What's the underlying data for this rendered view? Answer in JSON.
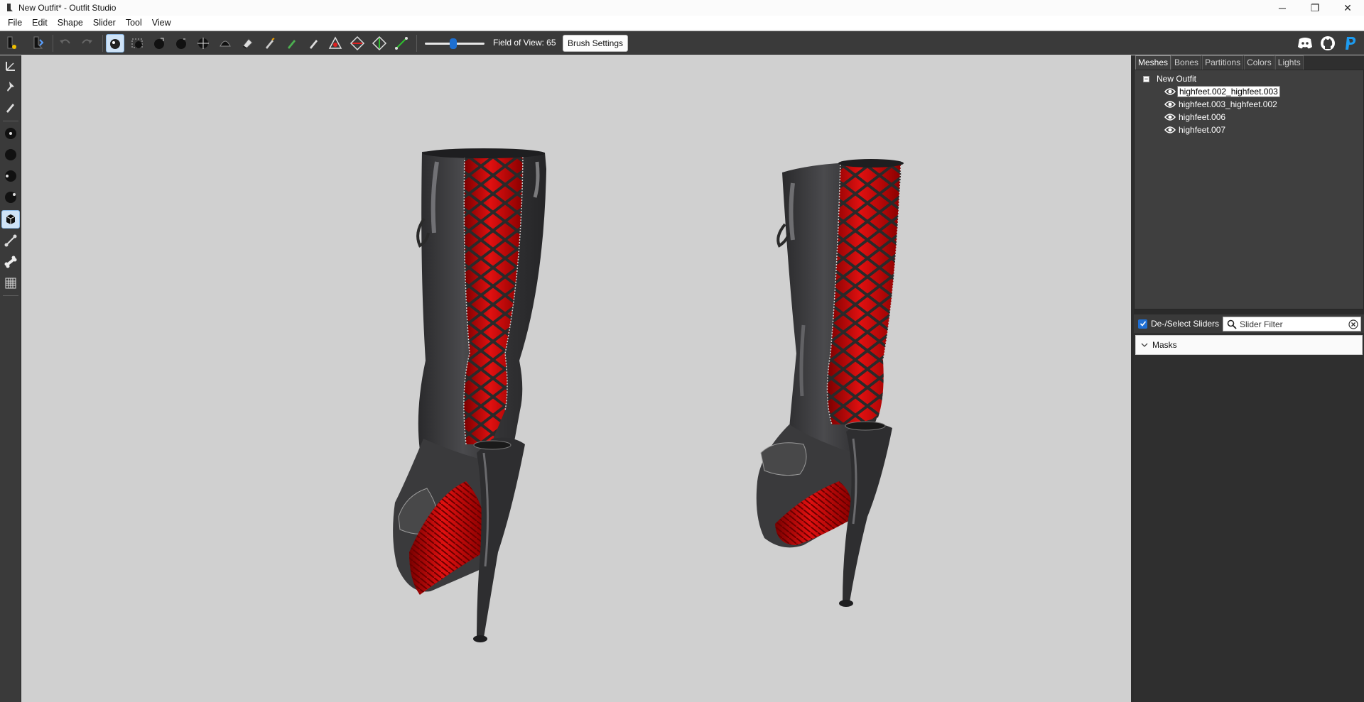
{
  "window": {
    "title": "New Outfit* - Outfit Studio",
    "minimize": "─",
    "restore": "❐",
    "close": "✕"
  },
  "menu": [
    "File",
    "Edit",
    "Shape",
    "Slider",
    "Tool",
    "View"
  ],
  "toolbar": {
    "fov_label": "Field of View: 65",
    "fov_value": 65,
    "fov_slider_fraction": 0.47,
    "brush_settings": "Brush Settings"
  },
  "tabs": [
    "Meshes",
    "Bones",
    "Partitions",
    "Colors",
    "Lights"
  ],
  "active_tab": "Meshes",
  "tree": {
    "root": "New Outfit",
    "items": [
      {
        "label": "highfeet.002_highfeet.003",
        "selected": true
      },
      {
        "label": "highfeet.003_highfeet.002",
        "selected": false
      },
      {
        "label": "highfeet.006",
        "selected": false
      },
      {
        "label": "highfeet.007",
        "selected": false
      }
    ]
  },
  "sliders": {
    "deselect_label": "De-/Select Sliders",
    "filter_placeholder": "Slider Filter",
    "masks_label": "Masks"
  },
  "colors": {
    "accent": "#1d6fd1",
    "boot_leather": "#3a3a3c",
    "boot_red": "#c00000"
  }
}
